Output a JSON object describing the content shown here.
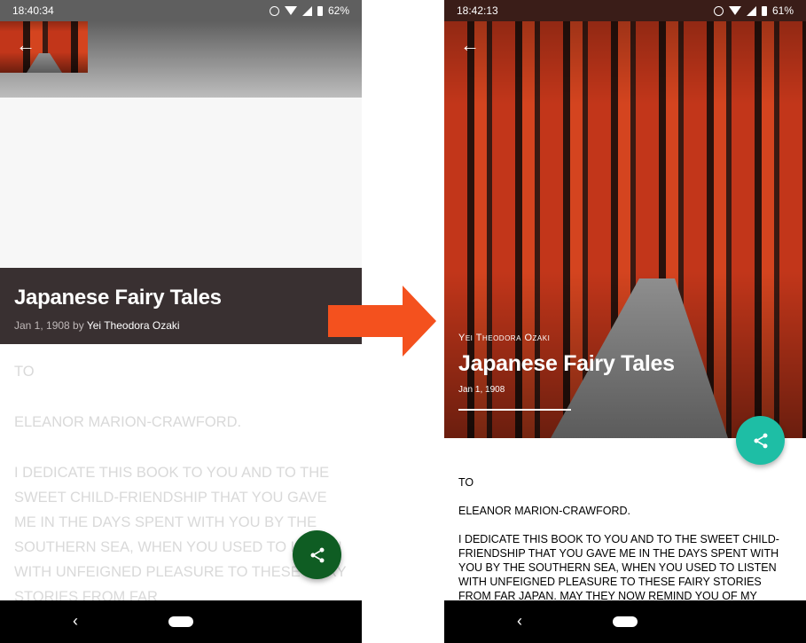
{
  "left": {
    "status": {
      "time": "18:40:34",
      "battery": "62%"
    },
    "book": {
      "title": "Japanese Fairy Tales",
      "date_by": "Jan 1, 1908 by",
      "author": "Yei Theodora Ozaki"
    },
    "body": [
      "TO",
      "ELEANOR MARION-CRAWFORD.",
      "I DEDICATE THIS BOOK TO YOU AND TO THE SWEET CHILD-FRIENDSHIP THAT YOU GAVE ME IN THE DAYS SPENT WITH YOU BY THE SOUTHERN SEA, WHEN YOU USED TO LISTEN WITH UNFEIGNED PLEASURE TO THESE FAIRY STORIES FROM FAR"
    ],
    "fab_color": "#0f5d23"
  },
  "right": {
    "status": {
      "time": "18:42:13",
      "battery": "61%"
    },
    "book": {
      "author": "Yei Theodora Ozaki",
      "title": "Japanese Fairy Tales",
      "date": "Jan 1, 1908"
    },
    "body": [
      "TO",
      "ELEANOR MARION-CRAWFORD.",
      "I DEDICATE THIS BOOK TO YOU AND TO THE SWEET CHILD-FRIENDSHIP THAT YOU GAVE ME IN THE DAYS SPENT WITH YOU BY THE SOUTHERN SEA, WHEN YOU USED TO LISTEN WITH UNFEIGNED PLEASURE TO THESE FAIRY STORIES FROM FAR JAPAN. MAY THEY NOW REMIND YOU OF MY"
    ],
    "fab_color": "#1ebea5"
  },
  "icons": {
    "back": "back-arrow-icon",
    "share": "share-icon",
    "transition": "right-arrow-icon"
  },
  "colors": {
    "arrow": "#f4511e",
    "title_bar": "#393031"
  }
}
